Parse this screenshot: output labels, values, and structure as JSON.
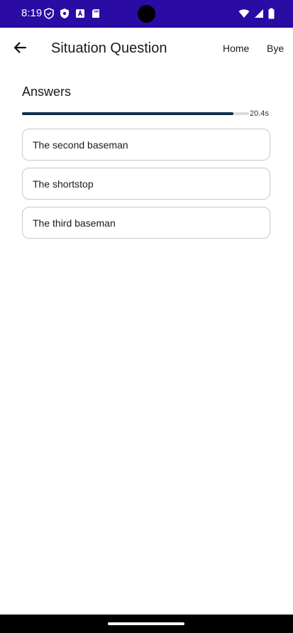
{
  "status_bar": {
    "time": "8:19",
    "left_icons": [
      "vpn-shield-icon",
      "security-shield-icon",
      "a-box-icon",
      "sd-card-icon"
    ],
    "right_icons": [
      "wifi-icon",
      "signal-icon",
      "battery-icon"
    ],
    "background_color": "#2a0ba4"
  },
  "app_bar": {
    "title": "Situation Question",
    "back_icon": "arrow-back-icon",
    "nav_home": "Home",
    "nav_bye": "Bye"
  },
  "answers": {
    "title": "Answers",
    "timer_text": "20.4s",
    "timer_progress": 0.93,
    "options": [
      {
        "label": "The second baseman"
      },
      {
        "label": "The shortstop"
      },
      {
        "label": "The third baseman"
      }
    ]
  },
  "colors": {
    "accent": "#10304e",
    "track": "#dcdcdc"
  }
}
